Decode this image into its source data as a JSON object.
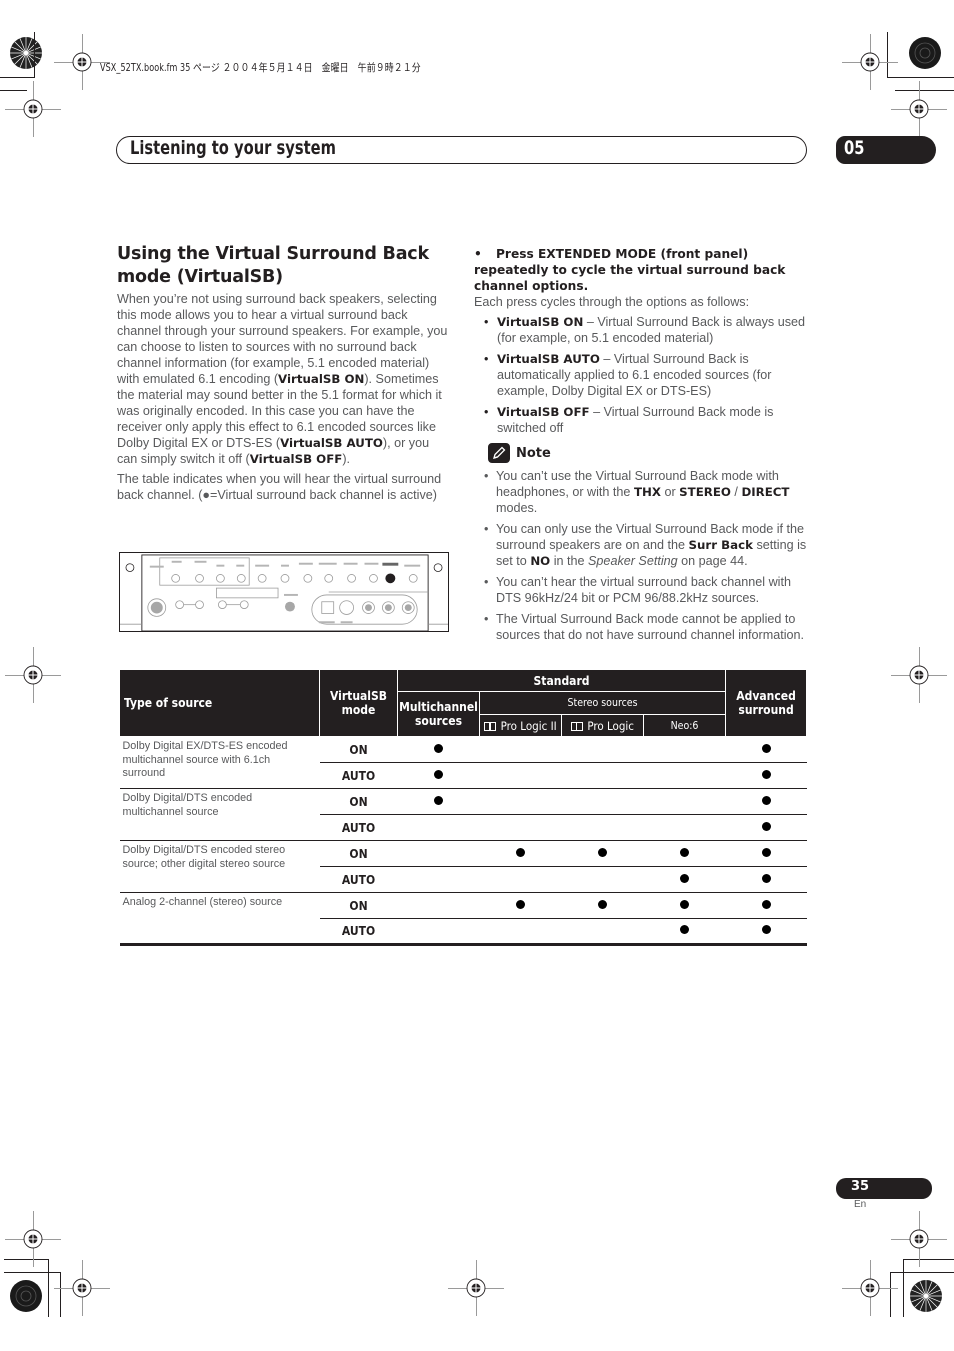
{
  "print_meta": "VSX_52TX.book.fm  35 ページ  ２００４年５月１４日　金曜日　午前９時２１分",
  "header": {
    "title": "Listening to your system",
    "chapter": "05"
  },
  "left": {
    "section_title": "Using the Virtual Surround Back mode (VirtualSB)",
    "para1": {
      "t1": "When you’re not using surround back speakers, selecting this mode allows you to hear a virtual surround back channel through your surround speakers. For example, you can choose to listen to sources with no surround back channel information (for example, 5.1 encoded material) with emulated 6.1 encoding (",
      "b1": "VirtualSB ON",
      "t2": "). Sometimes the material may sound better in the 5.1 format for which it was originally encoded. In this case you can have the receiver only apply this effect to 6.1 encoded sources like Dolby Digital EX or DTS-ES (",
      "b2": "VirtualSB AUTO",
      "t3": "), or you can simply switch it off (",
      "b3": "VirtualSB OFF",
      "t4": ")."
    },
    "para2": "The table indicates when you will hear the virtual surround back channel. (●=Virtual surround back channel is active)"
  },
  "front_panel": {
    "highlighted_button": "EXTENDED MODE"
  },
  "right": {
    "step_bullet": "•",
    "step": "Press EXTENDED MODE (front panel) repeatedly to cycle the virtual surround back channel options.",
    "step_desc": "Each press cycles through the options as follows:",
    "options": [
      {
        "name": "VirtualSB ON",
        "desc": " – Virtual Surround Back is always used (for example, on 5.1 encoded material)"
      },
      {
        "name": "VirtualSB AUTO",
        "desc": " – Virtual Surround Back is automatically applied to 6.1 encoded sources (for example, Dolby Digital EX or DTS-ES)"
      },
      {
        "name": "VirtualSB OFF",
        "desc": " – Virtual Surround Back mode is switched off"
      }
    ],
    "note": {
      "label": "Note",
      "items": [
        {
          "a": "You can’t use the Virtual Surround Back mode with headphones, or with the ",
          "b1": "THX",
          "c": " or ",
          "b2": "STEREO",
          "d": " / ",
          "b3": "DIRECT",
          "e": " modes."
        },
        {
          "a": "You can only use the Virtual Surround Back mode if the surround speakers are on and the ",
          "b1": "Surr Back",
          "c": " setting is set to ",
          "b2": "NO",
          "d": " in the ",
          "i1": "Speaker Setting",
          "e": " on page 44."
        },
        {
          "a": "You can’t hear the virtual surround back channel with DTS 96kHz/24 bit or PCM 96/88.2kHz sources."
        },
        {
          "a": "The Virtual Surround Back mode cannot be applied to sources that do not have surround channel information."
        }
      ]
    }
  },
  "table": {
    "headers": {
      "type_of_source": "Type of source",
      "virtualsb_mode": "VirtualSB mode",
      "standard": "Standard",
      "multichannel": "Multichannel sources",
      "stereo_sources": "Stereo sources",
      "pl2": "ꟷ Pro Logic II",
      "pl": "Pro Logic",
      "pl2_label": "Pro Logic II",
      "neo6": "Neo:6",
      "advanced": "Advanced surround"
    },
    "active_marker": "●",
    "rows": [
      {
        "source": "Dolby Digital EX/DTS-ES encoded multichannel source with 6.1ch surround",
        "modes": [
          {
            "mode": "ON",
            "multichannel": true,
            "pl2": false,
            "pl": false,
            "neo6": false,
            "advanced": true
          },
          {
            "mode": "AUTO",
            "multichannel": true,
            "pl2": false,
            "pl": false,
            "neo6": false,
            "advanced": true
          }
        ]
      },
      {
        "source": "Dolby Digital/DTS encoded multichannel source",
        "modes": [
          {
            "mode": "ON",
            "multichannel": true,
            "pl2": false,
            "pl": false,
            "neo6": false,
            "advanced": true
          },
          {
            "mode": "AUTO",
            "multichannel": false,
            "pl2": false,
            "pl": false,
            "neo6": false,
            "advanced": true
          }
        ]
      },
      {
        "source": "Dolby Digital/DTS encoded stereo source; other digital stereo source",
        "modes": [
          {
            "mode": "ON",
            "multichannel": false,
            "pl2": true,
            "pl": true,
            "neo6": true,
            "advanced": true
          },
          {
            "mode": "AUTO",
            "multichannel": false,
            "pl2": false,
            "pl": false,
            "neo6": true,
            "advanced": true
          }
        ]
      },
      {
        "source": "Analog 2-channel (stereo) source",
        "modes": [
          {
            "mode": "ON",
            "multichannel": false,
            "pl2": true,
            "pl": true,
            "neo6": true,
            "advanced": true
          },
          {
            "mode": "AUTO",
            "multichannel": false,
            "pl2": false,
            "pl": false,
            "neo6": true,
            "advanced": true
          }
        ]
      }
    ]
  },
  "footer": {
    "page": "35",
    "lang": "En"
  }
}
